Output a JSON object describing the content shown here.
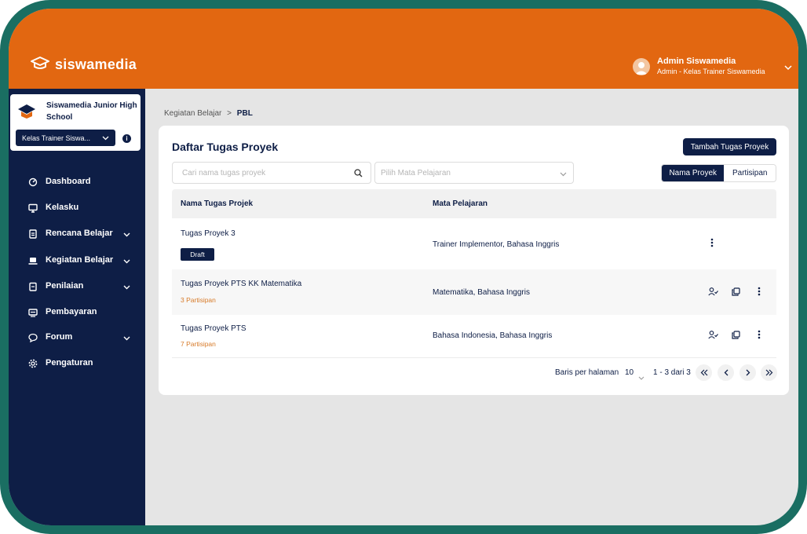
{
  "app": {
    "brand": "siswamedia"
  },
  "user": {
    "name": "Admin Siswamedia",
    "role": "Admin - Kelas Trainer Siswamedia"
  },
  "school": {
    "name": "Siswamedia Junior High School",
    "class_selected": "Kelas Trainer Siswa..."
  },
  "sidebar": {
    "items": [
      {
        "label": "Dashboard",
        "icon": "dashboard-icon",
        "expandable": false
      },
      {
        "label": "Kelasku",
        "icon": "monitor-icon",
        "expandable": false
      },
      {
        "label": "Rencana Belajar",
        "icon": "document-icon",
        "expandable": true
      },
      {
        "label": "Kegiatan Belajar",
        "icon": "laptop-icon",
        "expandable": true
      },
      {
        "label": "Penilaian",
        "icon": "clipboard-icon",
        "expandable": true
      },
      {
        "label": "Pembayaran",
        "icon": "payment-icon",
        "expandable": false
      },
      {
        "label": "Forum",
        "icon": "chat-icon",
        "expandable": true
      },
      {
        "label": "Pengaturan",
        "icon": "gear-icon",
        "expandable": false
      }
    ]
  },
  "breadcrumb": {
    "parent": "Kegiatan Belajar",
    "separator": ">",
    "current": "PBL"
  },
  "main": {
    "title": "Daftar Tugas Proyek",
    "add_button": "Tambah Tugas Proyek",
    "search_placeholder": "Cari nama tugas proyek",
    "subject_placeholder": "Pilih Mata Pelajaran",
    "view_toggle": {
      "active": "Nama Proyek",
      "other": "Partisipan"
    },
    "table": {
      "headers": [
        "Nama Tugas Projek",
        "Mata Pelajaran"
      ],
      "rows": [
        {
          "name": "Tugas Proyek 3",
          "badge": "Draft",
          "participants": "",
          "subject": "Trainer Implementor, Bahasa Inggris"
        },
        {
          "name": "Tugas Proyek PTS KK Matematika",
          "badge": "",
          "participants": "3 Partisipan",
          "subject": "Matematika, Bahasa Inggris"
        },
        {
          "name": "Tugas Proyek PTS",
          "badge": "",
          "participants": "7 Partisipan",
          "subject": "Bahasa Indonesia, Bahasa Inggris"
        }
      ]
    },
    "pagination": {
      "rows_label": "Baris per halaman",
      "rows_per_page": "10",
      "range": "1 - 3 dari 3"
    }
  },
  "colors": {
    "brand_orange": "#e26711",
    "navy": "#0e1e46",
    "frame": "#1a6e62",
    "participant": "#d77a28"
  }
}
